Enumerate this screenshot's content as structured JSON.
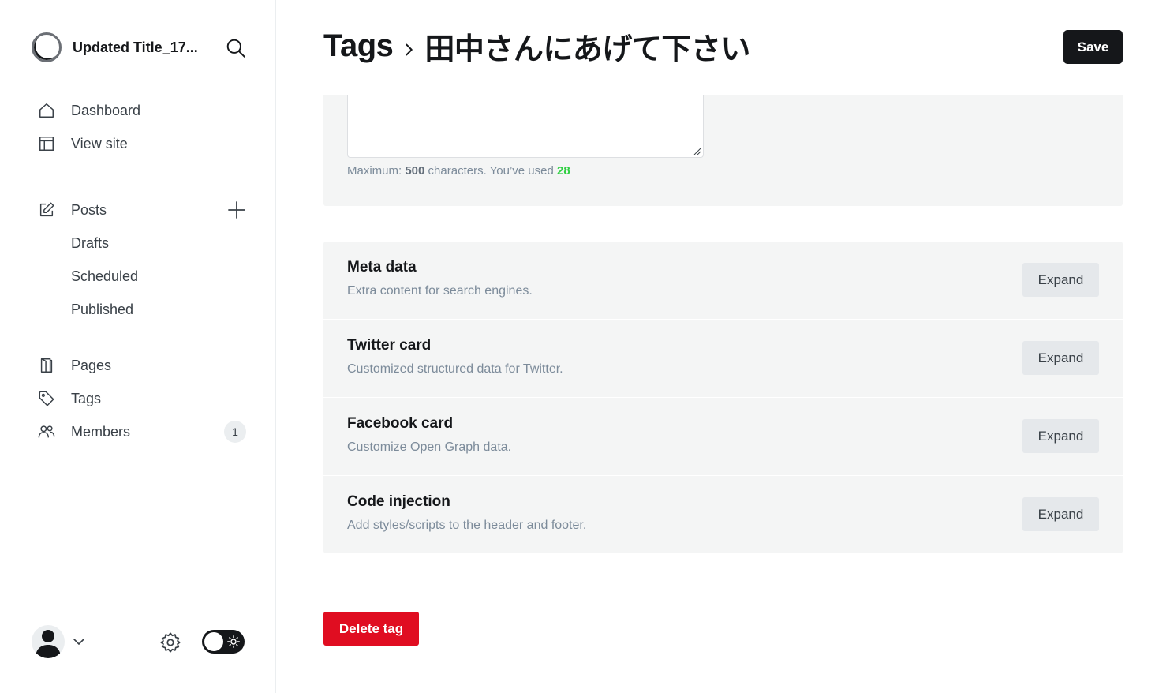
{
  "sidebar": {
    "site_title": "Updated Title_17...",
    "nav_primary": [
      {
        "label": "Dashboard",
        "icon": "home-icon"
      },
      {
        "label": "View site",
        "icon": "layout-icon"
      }
    ],
    "posts": {
      "label": "Posts",
      "icon": "edit-icon",
      "sub_items": [
        "Drafts",
        "Scheduled",
        "Published"
      ]
    },
    "nav_secondary": [
      {
        "label": "Pages",
        "icon": "page-icon"
      },
      {
        "label": "Tags",
        "icon": "tag-icon"
      },
      {
        "label": "Members",
        "icon": "members-icon",
        "badge": "1"
      }
    ]
  },
  "header": {
    "breadcrumb_parent": "Tags",
    "breadcrumb_current": "田中さんにあげて下さい",
    "save_label": "Save"
  },
  "description": {
    "prefix": "Maximum: ",
    "max": "500",
    "middle": " characters. You’ve used ",
    "used": "28"
  },
  "sections": [
    {
      "title": "Meta data",
      "desc": "Extra content for search engines.",
      "button": "Expand"
    },
    {
      "title": "Twitter card",
      "desc": "Customized structured data for Twitter.",
      "button": "Expand"
    },
    {
      "title": "Facebook card",
      "desc": "Customize Open Graph data.",
      "button": "Expand"
    },
    {
      "title": "Code injection",
      "desc": "Add styles/scripts to the header and footer.",
      "button": "Expand"
    }
  ],
  "delete_label": "Delete tag",
  "colors": {
    "primary_dark": "#15171a",
    "danger": "#e00d21",
    "success": "#30cf43",
    "panel_bg": "#f4f5f5"
  }
}
